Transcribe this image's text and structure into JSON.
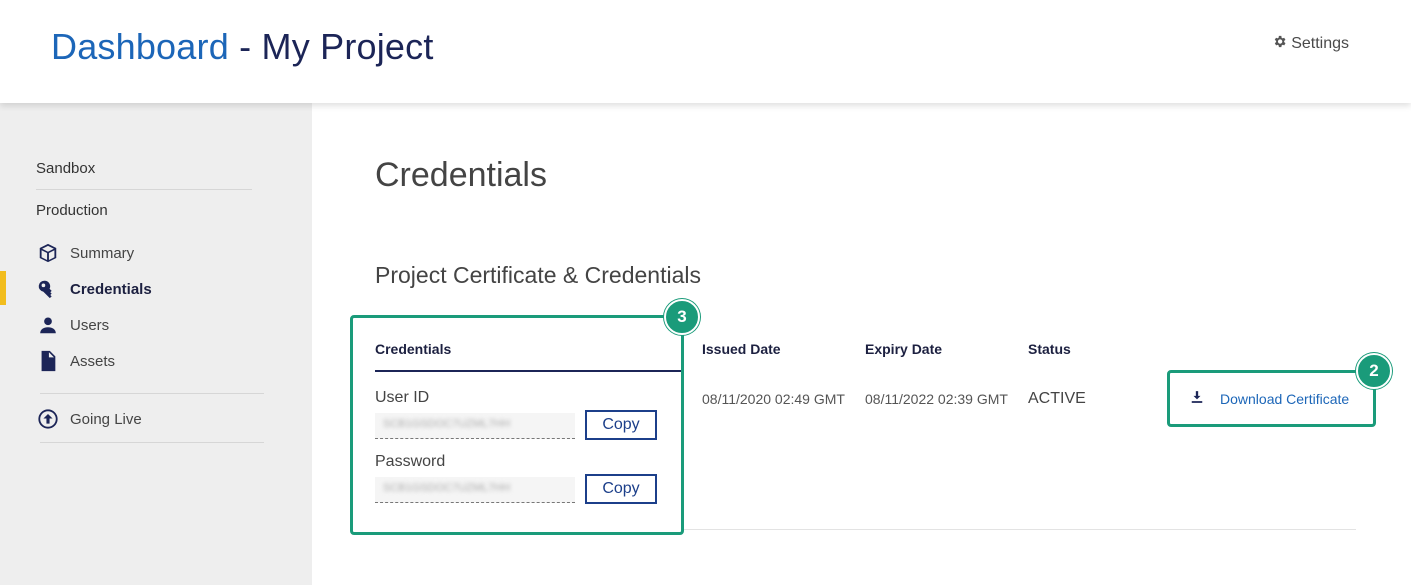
{
  "header": {
    "title_primary": "Dashboard",
    "title_separator": " - ",
    "title_secondary": "My Project",
    "settings_label": "Settings",
    "settings_icon": "gear-icon"
  },
  "sidebar": {
    "sections": [
      "Sandbox",
      "Production"
    ],
    "items": [
      {
        "label": "Summary",
        "icon": "cube-icon",
        "active": false
      },
      {
        "label": "Credentials",
        "icon": "key-icon",
        "active": true
      },
      {
        "label": "Users",
        "icon": "user-icon",
        "active": false
      },
      {
        "label": "Assets",
        "icon": "file-icon",
        "active": false
      }
    ],
    "going_live": {
      "label": "Going Live",
      "icon": "arrow-up-circle-icon"
    }
  },
  "main": {
    "page_title": "Credentials",
    "section_title": "Project Certificate & Credentials",
    "table": {
      "headers": [
        "Credentials",
        "Issued Date",
        "Expiry Date",
        "Status"
      ],
      "issued_date": "08/11/2020 02:49 GMT",
      "expiry_date": "08/11/2022 02:39 GMT",
      "status": "ACTIVE",
      "download_label": "Download Certificate"
    },
    "credentials": {
      "user_id_label": "User ID",
      "user_id_value": "SCB1GSDOC7UZML7HH",
      "password_label": "Password",
      "password_value": "SCB1GSDOC7UZML7HH",
      "copy_label": "Copy"
    }
  },
  "annotations": {
    "badge_credentials": "3",
    "badge_download": "2"
  },
  "colors": {
    "primary_blue": "#1c66b8",
    "navy": "#1c2557",
    "active_marker": "#f2bd1d",
    "callout_green": "#1a9b7a"
  }
}
